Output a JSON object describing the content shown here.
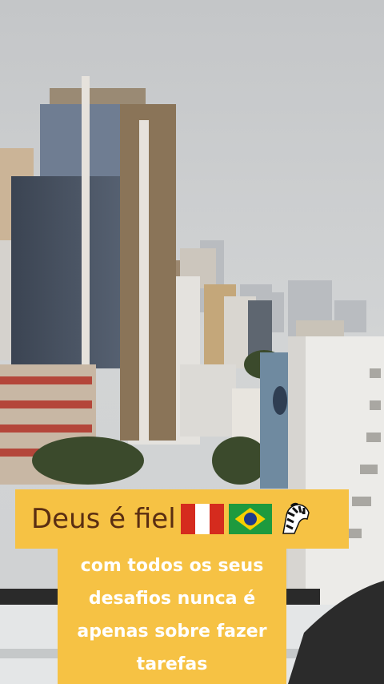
{
  "caption": {
    "title": "Deus é fiel",
    "title_emojis": [
      "peru-flag-icon",
      "brazil-flag-icon",
      "zebra-icon"
    ],
    "body_lines": [
      "com todos os seus",
      "desafios nunca é",
      "apenas sobre fazer",
      "tarefas"
    ]
  },
  "colors": {
    "caption_bg": "#f6c244",
    "title_text": "#5a2e12",
    "body_text": "#ffffff"
  }
}
